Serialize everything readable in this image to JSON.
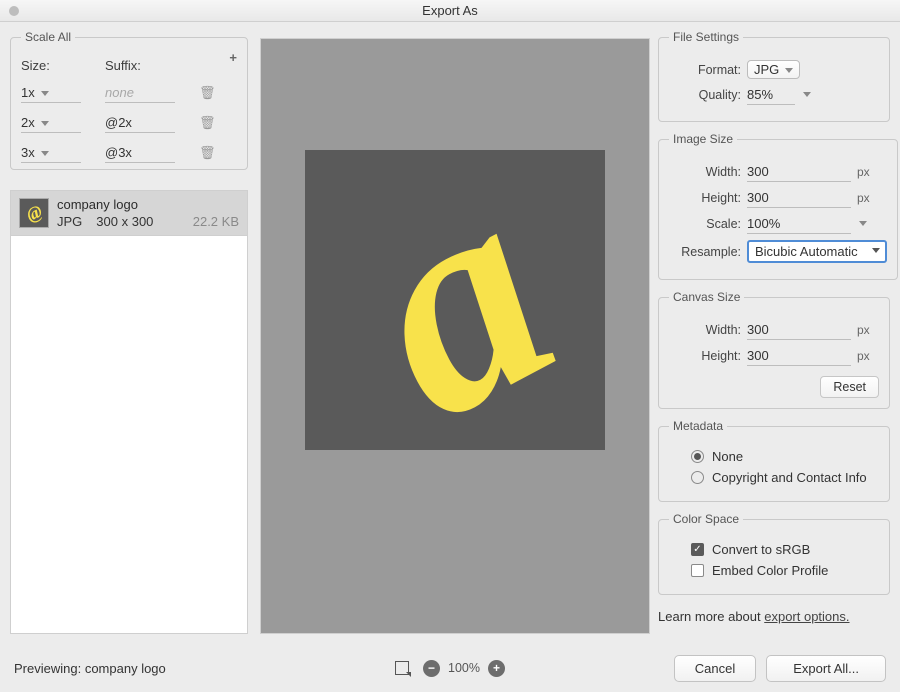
{
  "window": {
    "title": "Export As"
  },
  "scaleAll": {
    "legend": "Scale All",
    "sizeLabel": "Size:",
    "suffixLabel": "Suffix:",
    "suffixPlaceholder": "none",
    "rows": [
      {
        "size": "1x",
        "suffix": ""
      },
      {
        "size": "2x",
        "suffix": "@2x"
      },
      {
        "size": "3x",
        "suffix": "@3x"
      }
    ]
  },
  "asset": {
    "name": "company logo",
    "format": "JPG",
    "dimensions": "300 x 300",
    "filesize": "22.2 KB"
  },
  "fileSettings": {
    "legend": "File Settings",
    "formatLabel": "Format:",
    "formatValue": "JPG",
    "qualityLabel": "Quality:",
    "qualityValue": "85%"
  },
  "imageSize": {
    "legend": "Image Size",
    "widthLabel": "Width:",
    "widthValue": "300",
    "heightLabel": "Height:",
    "heightValue": "300",
    "scaleLabel": "Scale:",
    "scaleValue": "100%",
    "resampleLabel": "Resample:",
    "resampleValue": "Bicubic Automatic",
    "unit": "px"
  },
  "canvasSize": {
    "legend": "Canvas Size",
    "widthLabel": "Width:",
    "widthValue": "300",
    "heightLabel": "Height:",
    "heightValue": "300",
    "unit": "px",
    "resetLabel": "Reset"
  },
  "metadata": {
    "legend": "Metadata",
    "noneLabel": "None",
    "copyrightLabel": "Copyright and Contact Info",
    "selected": "none"
  },
  "colorSpace": {
    "legend": "Color Space",
    "convertLabel": "Convert to sRGB",
    "convertChecked": true,
    "embedLabel": "Embed Color Profile",
    "embedChecked": false
  },
  "learnMore": {
    "prefix": "Learn more about ",
    "link": "export options."
  },
  "footer": {
    "previewingLabel": "Previewing:",
    "previewingTarget": "company logo",
    "zoom": "100%",
    "cancel": "Cancel",
    "exportAll": "Export All..."
  }
}
